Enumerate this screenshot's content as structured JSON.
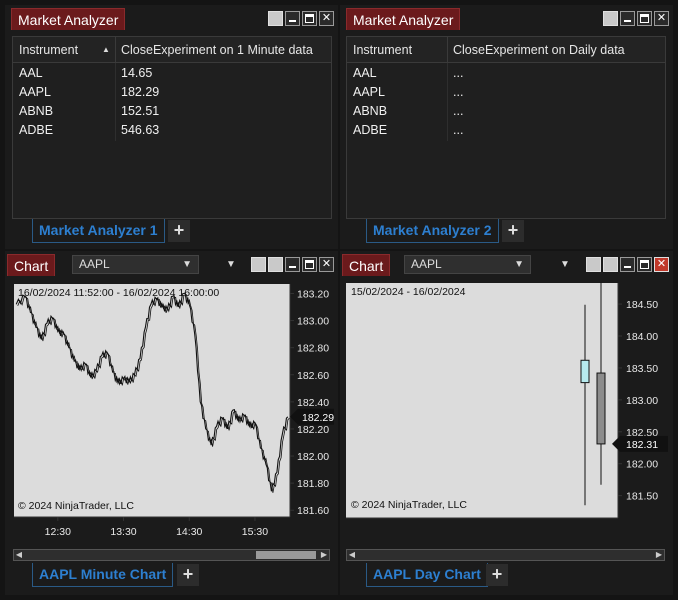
{
  "analyzer1": {
    "title": "Market Analyzer",
    "col_instrument": "Instrument",
    "col_value": "CloseExperiment on 1 Minute data",
    "rows": [
      {
        "instrument": "AAL",
        "value": "14.65"
      },
      {
        "instrument": "AAPL",
        "value": "182.29"
      },
      {
        "instrument": "ABNB",
        "value": "152.51"
      },
      {
        "instrument": "ADBE",
        "value": "546.63"
      }
    ],
    "tab_label": "Market Analyzer 1",
    "add_tab": "+"
  },
  "analyzer2": {
    "title": "Market Analyzer",
    "col_instrument": "Instrument",
    "col_value": "CloseExperiment on Daily data",
    "rows": [
      {
        "instrument": "AAL",
        "value": "..."
      },
      {
        "instrument": "AAPL",
        "value": "..."
      },
      {
        "instrument": "ABNB",
        "value": "..."
      },
      {
        "instrument": "ADBE",
        "value": "..."
      }
    ],
    "tab_label": "Market Analyzer 2",
    "add_tab": "+"
  },
  "chart1": {
    "title": "Chart",
    "instrument": "AAPL",
    "tab_label": "AAPL Minute Chart",
    "add_tab": "+",
    "chart_data": {
      "type": "line",
      "title": "16/02/2024 11:52:00 - 16/02/2024 16:00:00",
      "copyright": "© 2024 NinjaTrader, LLC",
      "x_tick_labels": [
        "12:30",
        "13:30",
        "14:30",
        "15:30"
      ],
      "y_tick_labels": [
        "183.20",
        "183.00",
        "182.80",
        "182.60",
        "182.40",
        "182.20",
        "182.00",
        "181.80",
        "181.60"
      ],
      "ylim": [
        181.55,
        183.27
      ],
      "last_price": "182.29",
      "series": [
        {
          "x": [
            "11:52",
            "12:00",
            "12:05",
            "12:10",
            "12:15",
            "12:20",
            "12:25",
            "12:30",
            "12:35",
            "12:40",
            "12:45",
            "12:50",
            "12:55",
            "13:00",
            "13:05",
            "13:10",
            "13:15",
            "13:20",
            "13:25",
            "13:30",
            "13:35",
            "13:40",
            "13:45",
            "13:50",
            "13:55",
            "14:00",
            "14:05",
            "14:10",
            "14:15",
            "14:20",
            "14:25",
            "14:30",
            "14:35",
            "14:40",
            "14:45",
            "14:50",
            "14:55",
            "15:00",
            "15:05",
            "15:10",
            "15:15",
            "15:20",
            "15:25",
            "15:30",
            "15:35",
            "15:40",
            "15:45",
            "15:50",
            "15:55",
            "16:00"
          ],
          "y": [
            183.12,
            183.18,
            183.06,
            182.95,
            182.86,
            182.98,
            183.02,
            182.92,
            182.9,
            182.8,
            182.7,
            182.64,
            182.68,
            182.58,
            182.63,
            182.74,
            182.76,
            182.62,
            182.54,
            182.57,
            182.55,
            182.6,
            182.72,
            182.95,
            183.12,
            183.16,
            183.1,
            183.08,
            183.18,
            183.1,
            183.2,
            183.12,
            182.9,
            182.4,
            182.2,
            182.08,
            182.22,
            182.28,
            182.2,
            182.34,
            182.26,
            182.3,
            182.22,
            182.24,
            182.06,
            181.94,
            181.74,
            181.88,
            182.16,
            182.29
          ]
        }
      ]
    }
  },
  "chart2": {
    "title": "Chart",
    "instrument": "AAPL",
    "tab_label": "AAPL Day Chart",
    "add_tab": "+",
    "chart_data": {
      "type": "candlestick",
      "title": "15/02/2024 - 16/02/2024",
      "copyright": "© 2024 NinjaTrader, LLC",
      "y_tick_labels": [
        "184.50",
        "184.00",
        "183.50",
        "183.00",
        "182.50",
        "182.00",
        "181.50"
      ],
      "ylim": [
        181.15,
        184.83
      ],
      "last_price": "182.31",
      "candles": [
        {
          "date": "15/02/2024",
          "open": 183.27,
          "high": 184.49,
          "low": 181.35,
          "close": 183.62,
          "color": "#b7eaee"
        },
        {
          "date": "16/02/2024",
          "open": 183.42,
          "high": 184.85,
          "low": 181.67,
          "close": 182.31,
          "color": "#8c8c8c"
        }
      ]
    }
  },
  "colors": {
    "title_tag": "#6b1a1c",
    "tab_text": "#2d7fd0",
    "panel_bg": "#1b1b1b",
    "chart_bg": "#dcdcdc"
  }
}
